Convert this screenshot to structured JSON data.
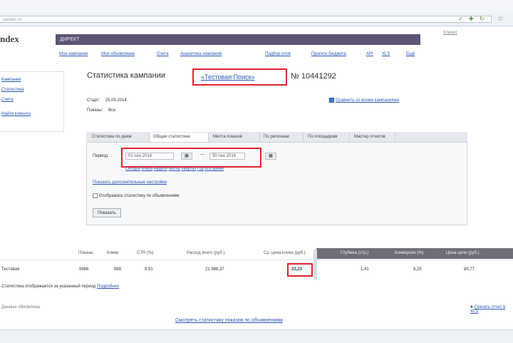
{
  "browser": {
    "url": "yandex.ru",
    "title": "Статистика кампании"
  },
  "logo": {
    "text": "ndex"
  },
  "topbar": {
    "label": "ДИРЕКТ",
    "right_text": "Клиент"
  },
  "nav": {
    "left": [
      "Мои кампании",
      "Мои объявления",
      "Счета",
      "Аналитика кампаний"
    ],
    "right": [
      "Подбор слов",
      "Прогноз бюджета",
      "API",
      "XLS",
      "Ещё"
    ]
  },
  "sidebar": {
    "items": [
      "Кампании",
      "Статистика",
      "Счета",
      "Найти клиента"
    ]
  },
  "header": {
    "title_prefix": "Статистика кампании",
    "campaign_name": "«Тестовая Поиск»",
    "campaign_id": "№ 10441292"
  },
  "meta": {
    "rows": [
      {
        "label": "Старт:",
        "value": "25.09.2014"
      },
      {
        "label": "Показы:",
        "value": "Все"
      }
    ]
  },
  "compare_checkbox_label": "Сравнить со всеми кампаниями",
  "tabs": [
    "Статистика по дням",
    "Общая статистика",
    "Места показов",
    "По регионам",
    "По площадкам",
    "Мастер отчетов"
  ],
  "active_tab": 1,
  "period": {
    "label": "Период:",
    "from": "01 сен 2014",
    "to": "30 сен 2014",
    "quick_links": [
      "Сегодня",
      "Вчера",
      "Неделя",
      "Месяц",
      "Квартал",
      "Год",
      "Всё время"
    ]
  },
  "extra_link": "Показать дополнительные настройки",
  "checkbox_ads_label": "Отображать статистику по объявлениям",
  "show_button": "Показать",
  "table": {
    "headers": [
      "Показы",
      "Клики",
      "CTR (%)",
      "Расход всего (руб.)",
      "Ср. цена клика (руб.)",
      "Глубина (стр.)",
      "Конверсия (%)",
      "Цена цели (руб.)"
    ],
    "row": {
      "name": "Тестовая",
      "values": [
        "9986",
        "989",
        "9,91",
        "21 988,37",
        "22,23",
        "1,41",
        "8,25",
        "80,77"
      ]
    }
  },
  "footnote": {
    "text": "Статистика отображается за указанный период",
    "link": "Подробнее"
  },
  "bottom_left": "Данные обновлены",
  "bottom_link": "Смотреть статистику показов по объявлениям",
  "bottom_right_link": "Скачать отчет в XLS"
}
